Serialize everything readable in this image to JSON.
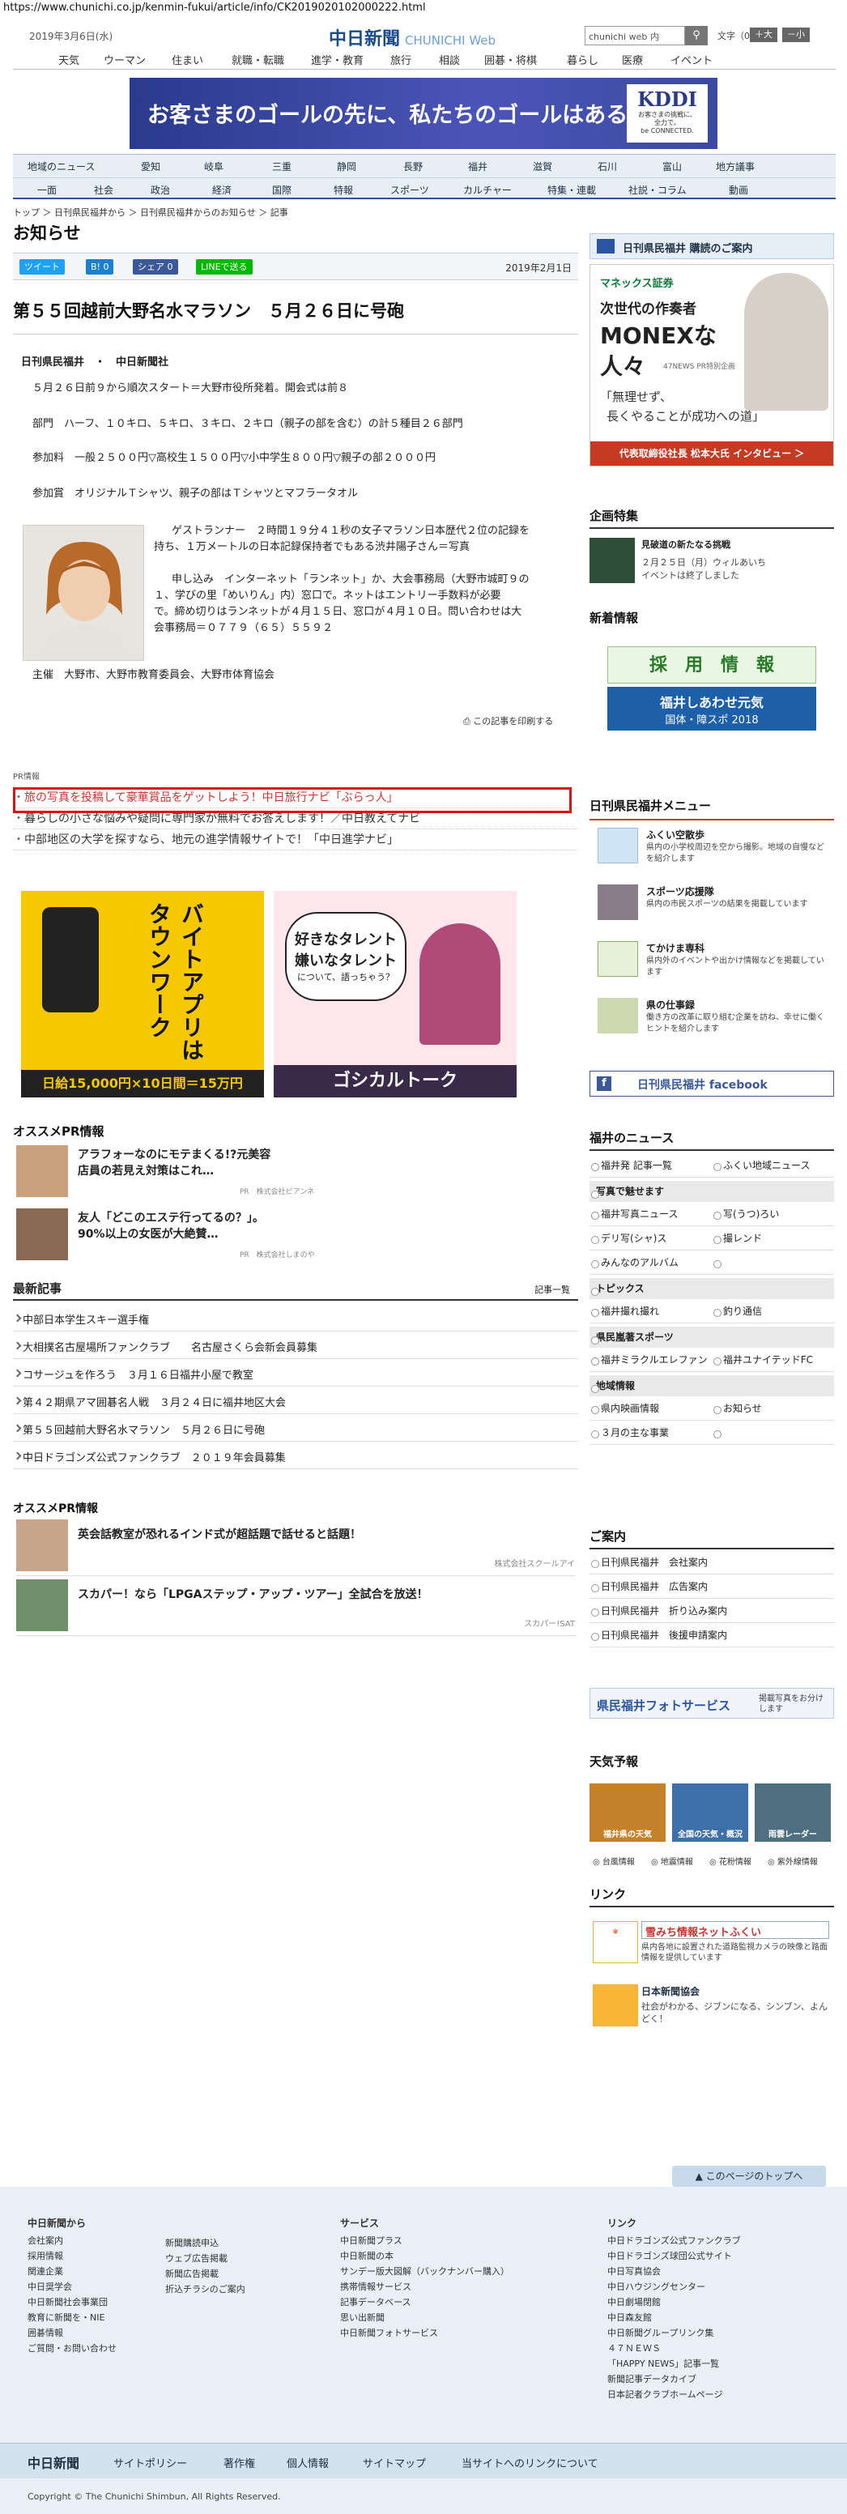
{
  "browser": {
    "url": "https://www.chunichi.co.jp/kenmin-fukui/article/info/CK2019020102000222.html"
  },
  "header": {
    "date": "2019年3月6日(水)",
    "logo": "中日新聞",
    "logo_sub": "CHUNICHI Web",
    "search_placeholder": "chunichi web 内",
    "search_icon": "search-icon",
    "font_size_label": "文字（0）",
    "font_large": "＋大",
    "font_small": "－小"
  },
  "global_nav": [
    "天気",
    "ウーマン",
    "住まい",
    "就職・転職",
    "進学・教育",
    "旅行",
    "相談",
    "囲碁・将棋",
    "暮らし",
    "医療",
    "イベント"
  ],
  "banner": {
    "text": "お客さまのゴールの先に、私たちのゴールはある。",
    "brand": "KDDI",
    "brand_sub1": "お客さまの挑戦に、",
    "brand_sub2": "全力で。",
    "brand_sub3": "be CONNECTED."
  },
  "region_nav": {
    "row1": [
      "地域のニュース",
      "愛知",
      "岐阜",
      "三重",
      "静岡",
      "長野",
      "福井",
      "滋賀",
      "石川",
      "富山",
      "地方議事"
    ],
    "row2": [
      "一面",
      "社会",
      "政治",
      "経済",
      "国際",
      "特報",
      "スポーツ",
      "カルチャー",
      "特集・連載",
      "社説・コラム",
      "動画"
    ]
  },
  "breadcrumb": "トップ ＞ 日刊県民福井から ＞ 日刊県民福井からのお知らせ ＞ 記事",
  "page_title": "お知らせ",
  "share": {
    "tweet": "ツイート",
    "hatena": "B! 0",
    "fb": "シェア 0",
    "line": "LINEで送る",
    "date": "2019年2月1日"
  },
  "article": {
    "title": "第５５回越前大野名水マラソン　５月２６日に号砲",
    "byline": "日刊県民福井　・　中日新聞社",
    "p1": "５月２６日前９から順次スタート＝大野市役所発着。開会式は前８",
    "p2": "部門　ハーフ、１０キロ、５キロ、３キロ、２キロ（親子の部を含む）の計５種目２６部門",
    "p3": "参加料　一般２５００円▽高校生１５００円▽小中学生８００円▽親子の部２０００円",
    "p4": "参加賞　オリジナルＴシャツ、親子の部はＴシャツとマフラータオル",
    "p5a": "ゲストランナー　２時間１９分４１秒の女子マラソン日本歴代２位の記録を",
    "p5b": "持ち、１万メートルの日本記録保持者でもある渋井陽子さん＝写真",
    "p6a": "申し込み　インターネット「ランネット」か、大会事務局（大野市城町９の",
    "p6b": "１、学びの里「めいりん」内）窓口で。ネットはエントリー手数料が必要",
    "p6c": "で。締め切りはランネットが４月１５日、窓口が４月１０日。問い合わせは大",
    "p6d": "会事務局＝０７７９（６５）５５９２",
    "p7": "主催　大野市、大野市教育委員会、大野市体育協会",
    "print": "この記事を印刷する"
  },
  "pr_info": {
    "head": "PR情報",
    "links": [
      "旅の写真を投稿して豪華賞品をゲットしよう！中日旅行ナビ「ぶらっ人」",
      "暮らしの小さな悩みや疑問に専門家が無料でお答えします！／中日教えてナビ",
      "中部地区の大学を探すなら、地元の進学情報サイトで！「中日進学ナビ」"
    ]
  },
  "ads": {
    "ad1_line1": "バイトアプリは",
    "ad1_line2": "タウンワーク",
    "ad1_price": "日給15,000円×10日間＝15万円",
    "ad2_line1": "好きなタレント",
    "ad2_line2": "嫌いなタレント",
    "ad2_line3": "について、語っちゃう？",
    "ad2_brand": "ゴシカルトーク"
  },
  "osusume1": {
    "head": "オススメPR情報",
    "items": [
      {
        "text1": "アラフォーなのにモテまくる!?元美容",
        "text2": "店員の若見え対策はこれ…",
        "sponsor": "PR　株式会社ピアンネ"
      },
      {
        "text1": "友人「どこのエステ行ってるの？」。",
        "text2": "90%以上の女医が大絶賛…",
        "sponsor": "PR　株式会社しまのや"
      }
    ]
  },
  "latest": {
    "head": "最新記事",
    "list_label": "記事一覧",
    "items": [
      "中部日本学生スキー選手権",
      "大相撲名古屋場所ファンクラブ　　名古屋さくら会新会員募集",
      "コサージュを作ろう　３月１６日福井小屋で教室",
      "第４２期県アマ囲碁名人戦　３月２４日に福井地区大会",
      "第５５回越前大野名水マラソン　５月２６日に号砲",
      "中日ドラゴンズ公式ファンクラブ　２０１９年会員募集"
    ]
  },
  "osusume2": {
    "head": "オススメPR情報",
    "items": [
      {
        "text": "英会話教室が恐れるインド式が超話題で話せると話題！",
        "sponsor": "株式会社スクールアイ"
      },
      {
        "text": "スカパー！なら「LPGAステップ・アップ・ツアー」全試合を放送！",
        "sponsor": "スカパー!SAT"
      }
    ]
  },
  "right": {
    "subscribe": "日刊県民福井 購読のご案内",
    "monex": {
      "brand": "マネックス証券",
      "line1": "次世代の作奏者",
      "line2": "MONEXな",
      "line3": "人々",
      "tag": "47NEWS PR特別企画",
      "quote1": "「無理せず、",
      "quote2": "長くやることが成功への道」",
      "foot": "代表取締役社長 松本大氏 インタビュー ＞"
    },
    "kikaku_head": "企画特集",
    "kikaku_title": "見破道の新たなる挑戦",
    "kikaku_desc1": "２月２５日（月）ウィルあいち",
    "kikaku_desc2": "イベントは終了しました",
    "shinchaku_head": "新着情報",
    "saiyo": "採　用　情　報",
    "kokutai1": "福井しあわせ元気",
    "kokutai2": "国体・障スポ 2018",
    "menu_head": "日刊県民福井メニュー",
    "menu": [
      {
        "title": "ふくい空散歩",
        "desc": "県内の小学校周辺を空から撮影。地域の自慢などを紹介します"
      },
      {
        "title": "スポーツ応援隊",
        "desc": "県内の市民スポーツの結果を掲載しています"
      },
      {
        "title": "てかけま専科",
        "desc": "県内外のイベントや出かけ情報などを掲載しています"
      },
      {
        "title": "県の仕事録",
        "desc": "働き方の改革に取り組む企業を訪ね、幸せに働くヒントを紹介します"
      }
    ],
    "facebook": "日刊県民福井 facebook",
    "news_head": "福井のニュース",
    "news_top": [
      "福井発 記事一覧",
      "ふくい地域ニュース"
    ],
    "photo_head": "写真で魅せます",
    "photo_items": [
      "福井写真ニュース",
      "写(うつ)ろい",
      "デリ写(シャ)ス",
      "撮レンド",
      "みんなのアルバム"
    ],
    "topics_head": "トピックス",
    "topics_items": [
      "福井撮れ撮れ",
      "釣り通信"
    ],
    "sports_head": "県民嵐著スポーツ",
    "sports_items": [
      "福井ミラクルエレファンツ",
      "福井ユナイテッドFC"
    ],
    "region_head": "地域情報",
    "region_items": [
      "県内映画情報",
      "お知らせ",
      "３月の主な事業"
    ],
    "annai_head": "ご案内",
    "annai_items": [
      "日刊県民福井　会社案内",
      "日刊県民福井　広告案内",
      "日刊県民福井　折り込み案内",
      "日刊県民福井　後援申請案内"
    ],
    "photoservice": "県民福井フォトサービス",
    "photoservice_desc": "掲載写真をお分けします",
    "weather_head": "天気予報",
    "weather_tiles": [
      "福井県の天気",
      "全国の天気・概況",
      "雨雲レーダー"
    ],
    "weather_links": [
      "台風情報",
      "地震情報",
      "花粉情報",
      "紫外線情報"
    ],
    "link_head": "リンク",
    "link1_title": "雪みち情報ネットふくい",
    "link1_desc": "県内各地に設置された道路監視カメラの映像と路面情報を提供しています",
    "link2_title": "日本新聞協会",
    "link2_desc": "社会がわかる、ジブンになる、シンブン、よんどく！"
  },
  "footer": {
    "to_top": "このページのトップへ",
    "col1_head": "中日新聞から",
    "col1": [
      "会社案内",
      "採用情報",
      "関連企業",
      "中日奨学会",
      "中日新聞社会事業団",
      "教育に新聞を・NIE",
      "囲碁情報",
      "ご質問・お問い合わせ"
    ],
    "col2": [
      "新聞購読申込",
      "ウェブ広告掲載",
      "新聞広告掲載",
      "折込チラシのご案内"
    ],
    "col3_head": "サービス",
    "col3": [
      "中日新聞プラス",
      "中日新聞の本",
      "サンデー版大図解（バックナンバー購入）",
      "携帯情報サービス",
      "記事データベース",
      "思い出新聞",
      "中日新聞フォトサービス"
    ],
    "col4_head": "リンク",
    "col4": [
      "中日ドラゴンズ公式ファンクラブ",
      "中日ドラゴンズ球団公式サイト",
      "中日写真協会",
      "中日ハウジングセンター",
      "中日劇場閉館",
      "中日森友館",
      "中日新聞グループリンク集",
      "４７ＮＥＷＳ",
      "「HAPPY NEWS」記事一覧",
      "新聞記事データカイブ",
      "日本記者クラブホームページ"
    ],
    "bar_logo": "中日新聞",
    "bar_links": [
      "サイトポリシー",
      "著作権",
      "個人情報",
      "サイトマップ",
      "当サイトへのリンクについて"
    ],
    "copyright": "Copyright © The Chunichi Shimbun, All Rights Reserved."
  }
}
